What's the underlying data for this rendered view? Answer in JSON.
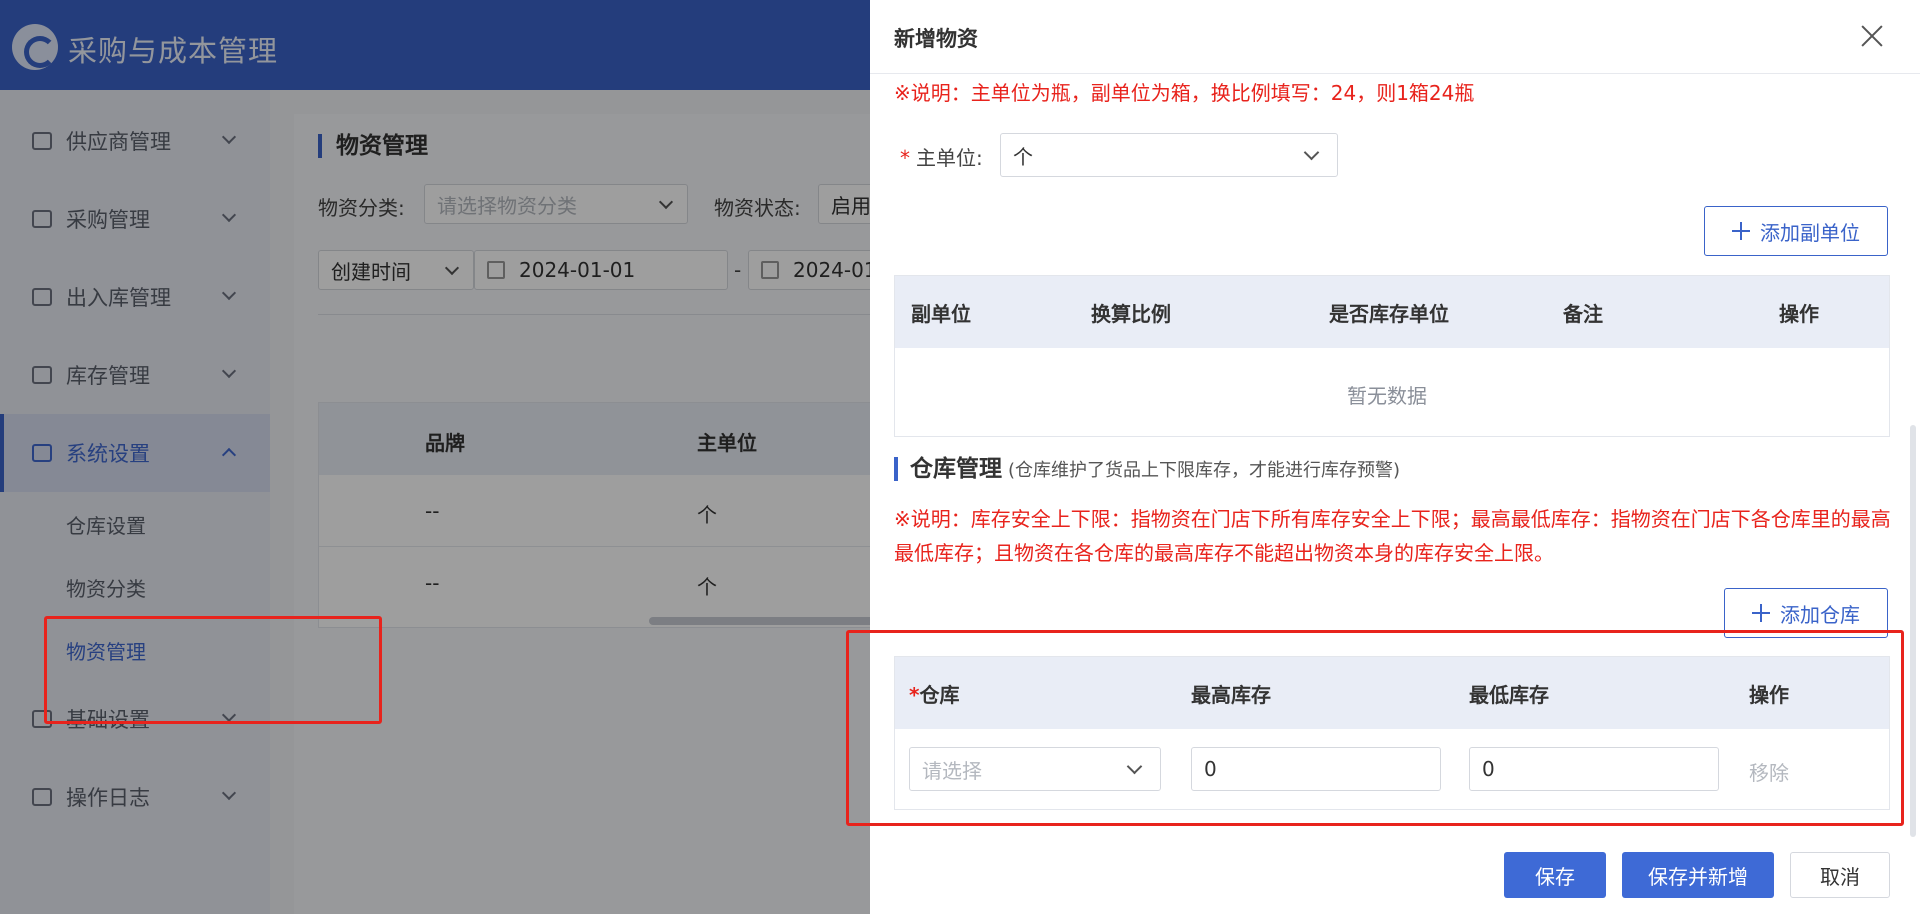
{
  "app": {
    "title": "采购与成本管理"
  },
  "sidebar": {
    "items": [
      {
        "label": "供应商管理"
      },
      {
        "label": "采购管理"
      },
      {
        "label": "出入库管理"
      },
      {
        "label": "库存管理"
      },
      {
        "label": "系统设置"
      },
      {
        "label": "基础设置"
      },
      {
        "label": "操作日志"
      }
    ],
    "sub_items": [
      {
        "label": "仓库设置"
      },
      {
        "label": "物资分类"
      },
      {
        "label": "物资管理"
      }
    ]
  },
  "main": {
    "section_title": "物资管理",
    "filters": {
      "category_label": "物资分类:",
      "category_placeholder": "请选择物资分类",
      "status_label": "物资状态:",
      "status_value": "启用",
      "time_type": "创建时间",
      "date_start": "2024-01-01",
      "date_separator": "-",
      "date_end": "2024-01"
    },
    "table": {
      "headers": [
        "品牌",
        "主单位"
      ],
      "rows": [
        [
          "--",
          "个"
        ],
        [
          "--",
          "个"
        ]
      ]
    }
  },
  "drawer": {
    "title": "新增物资",
    "unit_note": "※说明：主单位为瓶，副单位为箱，换比例填写：24，则1箱24瓶",
    "main_unit_label": "主单位:",
    "main_unit_value": "个",
    "add_sub_unit_label": "添加副单位",
    "sub_unit_table": {
      "headers": [
        "副单位",
        "换算比例",
        "是否库存单位",
        "备注",
        "操作"
      ],
      "empty_text": "暂无数据"
    },
    "warehouse_section": {
      "title": "仓库管理",
      "hint": "(仓库维护了货品上下限库存，才能进行库存预警)",
      "note": "※说明：库存安全上下限：指物资在门店下所有库存安全上下限；最高最低库存：指物资在门店下各仓库里的最高最低库存；且物资在各仓库的最高库存不能超出物资本身的库存安全上限。",
      "add_label": "添加仓库",
      "table": {
        "headers": [
          "仓库",
          "最高库存",
          "最低库存",
          "操作"
        ],
        "required_mark": "*",
        "row": {
          "warehouse_placeholder": "请选择",
          "max_stock": "0",
          "min_stock": "0",
          "remove_label": "移除"
        }
      }
    },
    "buttons": {
      "save": "保存",
      "save_and_new": "保存并新增",
      "cancel": "取消"
    }
  },
  "colors": {
    "brand": "#3a63c9",
    "primary_button": "#3e6ad6",
    "annotation_red": "#e8231c",
    "note_red": "#e8231c"
  },
  "icons": {
    "close": "close-icon",
    "plus": "plus-icon",
    "chevron": "chevron-down-icon",
    "calendar": "calendar-icon"
  }
}
